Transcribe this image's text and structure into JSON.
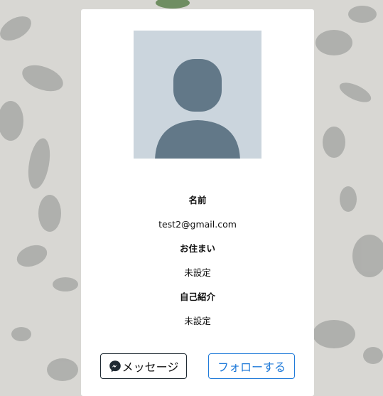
{
  "profile": {
    "name_label": "名前",
    "name_value": "test2@gmail.com",
    "address_label": "お住まい",
    "address_value": "未設定",
    "bio_label": "自己紹介",
    "bio_value": "未設定"
  },
  "actions": {
    "message_label": "メッセージ",
    "follow_label": "フォローする"
  },
  "icons": {
    "avatar": "default-avatar-icon",
    "message": "messenger-icon"
  },
  "colors": {
    "follow_accent": "#1f7ad9",
    "avatar_bg": "#cbd5dd",
    "avatar_fg": "#627888"
  }
}
